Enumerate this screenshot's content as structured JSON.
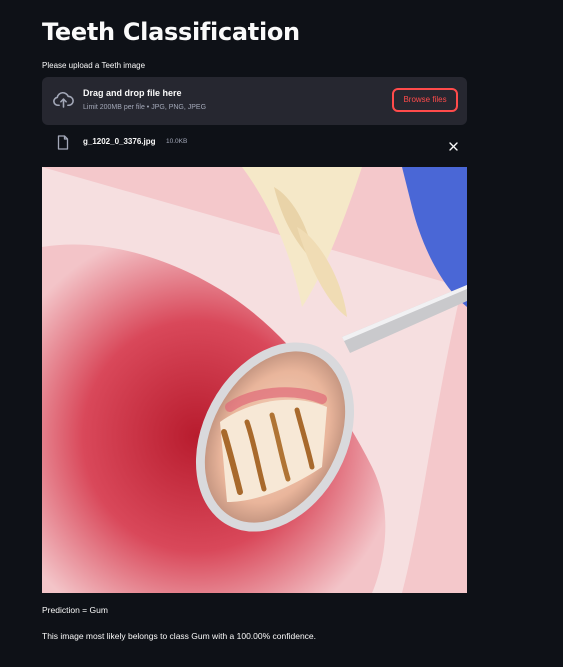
{
  "page": {
    "title": "Teeth Classification"
  },
  "uploader": {
    "label": "Please upload a Teeth image",
    "drop_title": "Drag and drop file here",
    "drop_limit": "Limit 200MB per file • JPG, PNG, JPEG",
    "browse_label": "Browse files",
    "icon": "cloud-upload-icon"
  },
  "uploaded_file": {
    "name": "g_1202_0_3376.jpg",
    "size": "10.0KB",
    "icon": "file-icon",
    "remove_icon": "close-icon"
  },
  "result": {
    "prediction": "Prediction = Gum",
    "message": "This image most likely belongs to class Gum with a 100.00% confidence."
  },
  "colors": {
    "background": "#0e1117",
    "panel": "#262730",
    "accent": "#ff4b4b",
    "text": "#fafafa",
    "muted": "#a3a8b8"
  }
}
